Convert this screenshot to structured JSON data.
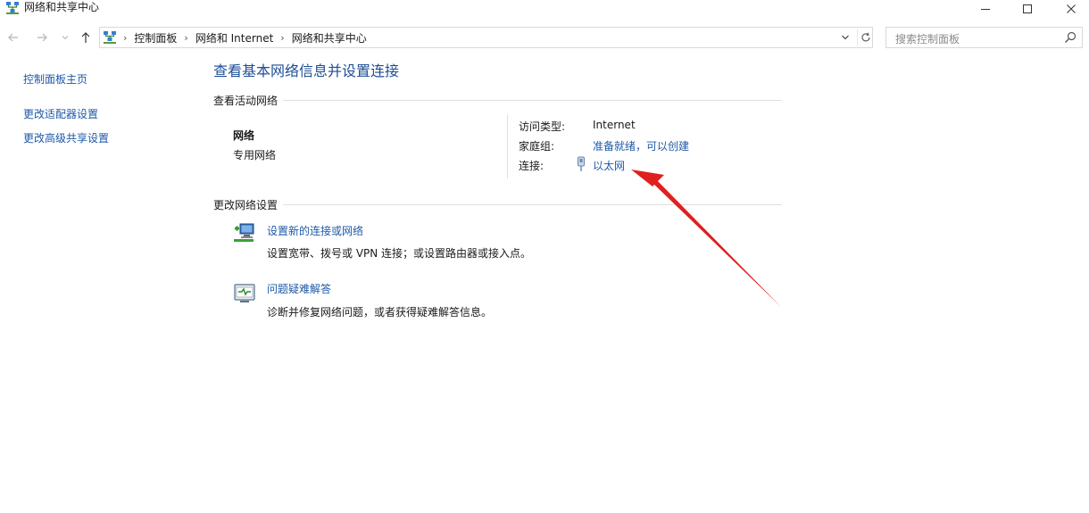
{
  "window": {
    "title": "网络和共享中心"
  },
  "nav": {
    "breadcrumb": [
      "控制面板",
      "网络和 Internet",
      "网络和共享中心"
    ],
    "search_placeholder": "搜索控制面板"
  },
  "sidebar": {
    "items": [
      {
        "label": "控制面板主页"
      },
      {
        "label": "更改适配器设置"
      },
      {
        "label": "更改高级共享设置"
      }
    ]
  },
  "main": {
    "title": "查看基本网络信息并设置连接",
    "active_section": "查看活动网络",
    "network": {
      "name": "网络",
      "type": "专用网络",
      "access_type_label": "访问类型:",
      "access_type_value": "Internet",
      "homegroup_label": "家庭组:",
      "homegroup_value": "准备就绪，可以创建",
      "connection_label": "连接:",
      "connection_value": "以太网"
    },
    "change_section": "更改网络设置",
    "tasks": [
      {
        "link": "设置新的连接或网络",
        "desc": "设置宽带、拨号或 VPN 连接；或设置路由器或接入点。",
        "icon": "network-setup-icon"
      },
      {
        "link": "问题疑难解答",
        "desc": "诊断并修复网络问题，或者获得疑难解答信息。",
        "icon": "troubleshoot-icon"
      }
    ]
  },
  "annotation": {
    "arrow_color": "#e0201f"
  },
  "colors": {
    "link": "#1e5aa8",
    "title": "#1e4e96"
  }
}
